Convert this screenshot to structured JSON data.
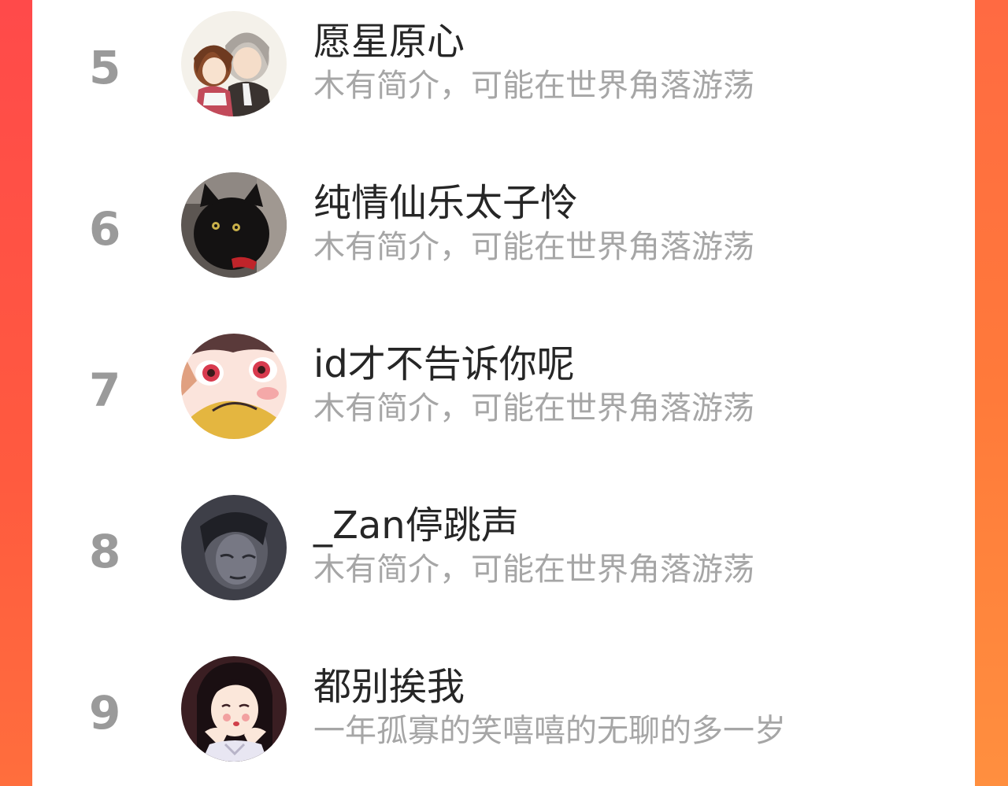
{
  "colors": {
    "background_gradient_top": "#ff4e45",
    "background_gradient_bottom": "#ff8a3d",
    "panel": "#ffffff",
    "rank_text": "#9a9a9a",
    "name_text": "#262626",
    "bio_text": "#a6a6a6"
  },
  "ranking": {
    "items": [
      {
        "rank": "5",
        "name": "愿星原心",
        "bio": "木有简介，可能在世界角落游荡",
        "avatar_icon": "anime-couple-avatar"
      },
      {
        "rank": "6",
        "name": "纯情仙乐太子怜",
        "bio": "木有简介，可能在世界角落游荡",
        "avatar_icon": "black-cat-avatar"
      },
      {
        "rank": "7",
        "name": "id才不告诉你呢",
        "bio": "木有简介，可能在世界角落游荡",
        "avatar_icon": "anime-face-avatar"
      },
      {
        "rank": "8",
        "name": "_Zan停跳声",
        "bio": "木有简介，可能在世界角落游荡",
        "avatar_icon": "dark-portrait-avatar"
      },
      {
        "rank": "9",
        "name": "都别挨我",
        "bio": "一年孤寡的笑嘻嘻的无聊的多一岁",
        "avatar_icon": "girl-illustration-avatar"
      }
    ]
  }
}
